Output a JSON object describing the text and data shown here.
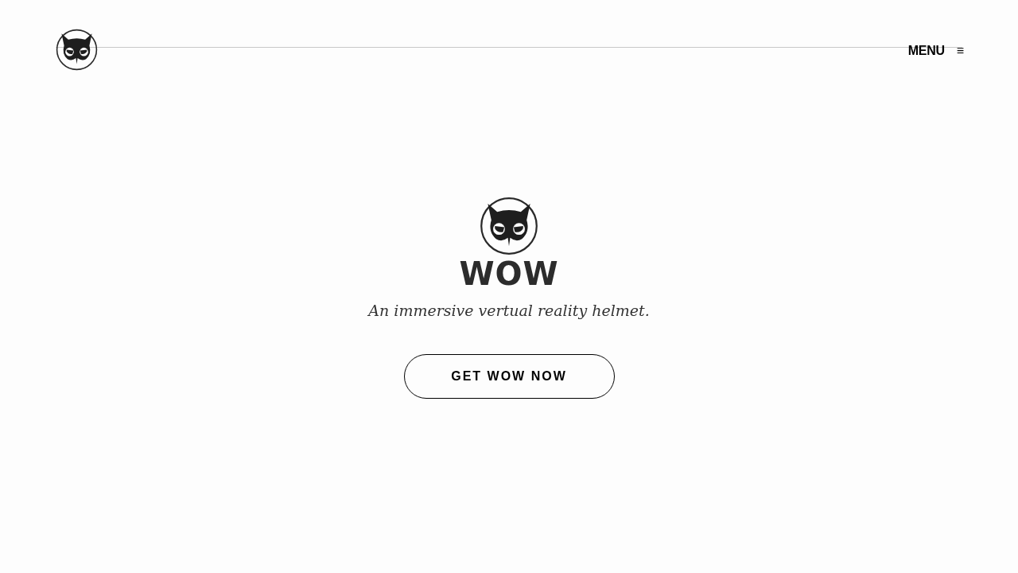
{
  "header": {
    "menu_label": "MENU",
    "menu_glyph": "≡"
  },
  "hero": {
    "brand": "WOW",
    "tagline": "An immersive vertual reality helmet.",
    "cta": "GET WOW NOW"
  }
}
